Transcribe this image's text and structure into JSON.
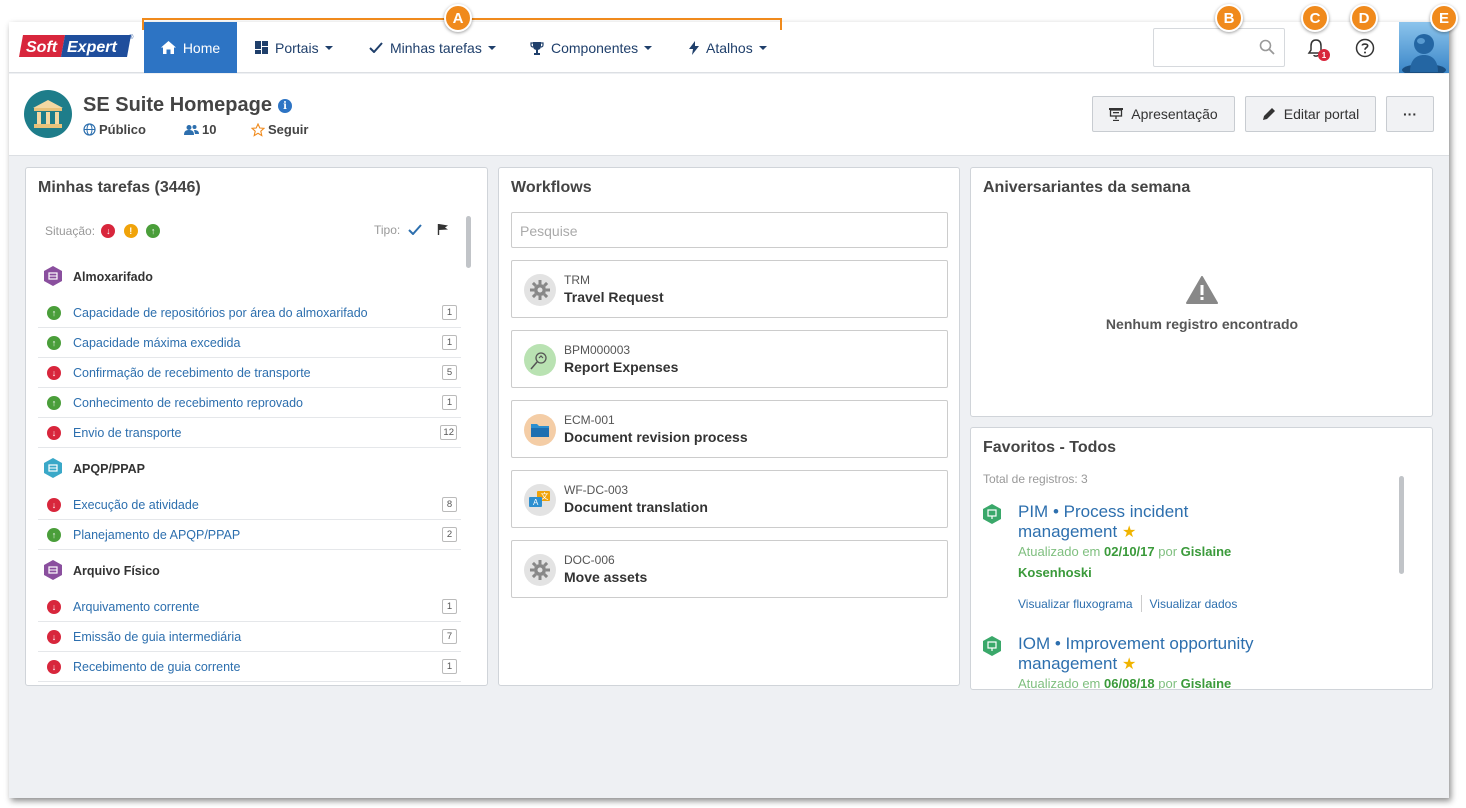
{
  "callouts": {
    "a": "A",
    "b": "B",
    "c": "C",
    "d": "D",
    "e": "E"
  },
  "brand": {
    "part1": "Soft",
    "part2": "Expert",
    "reg": "®"
  },
  "nav": {
    "home": "Home",
    "portais": "Portais",
    "minhas_tarefas": "Minhas tarefas",
    "componentes": "Componentes",
    "atalhos": "Atalhos"
  },
  "notifications": {
    "count": "1"
  },
  "header": {
    "title": "SE Suite Homepage",
    "visibility": "Público",
    "members": "10",
    "follow": "Seguir",
    "btn_presentation": "Apresentação",
    "btn_edit": "Editar portal",
    "btn_more": "···"
  },
  "tasks": {
    "title": "Minhas tarefas (3446)",
    "situacao_label": "Situação:",
    "tipo_label": "Tipo:",
    "groups": [
      {
        "name": "Almoxarifado",
        "color": "#8a4f9e",
        "items": [
          {
            "label": "Capacidade de repositórios por área do almoxarifado",
            "count": "1",
            "status": "green"
          },
          {
            "label": "Capacidade máxima excedida",
            "count": "1",
            "status": "green"
          },
          {
            "label": "Confirmação de recebimento de transporte",
            "count": "5",
            "status": "red"
          },
          {
            "label": "Conhecimento de recebimento reprovado",
            "count": "1",
            "status": "green"
          },
          {
            "label": "Envio de transporte",
            "count": "12",
            "status": "red"
          }
        ]
      },
      {
        "name": "APQP/PPAP",
        "color": "#3aa8c8",
        "items": [
          {
            "label": "Execução de atividade",
            "count": "8",
            "status": "red"
          },
          {
            "label": "Planejamento de APQP/PPAP",
            "count": "2",
            "status": "green"
          }
        ]
      },
      {
        "name": "Arquivo Físico",
        "color": "#8a4f9e",
        "items": [
          {
            "label": "Arquivamento corrente",
            "count": "1",
            "status": "red"
          },
          {
            "label": "Emissão de guia intermediária",
            "count": "7",
            "status": "red"
          },
          {
            "label": "Recebimento de guia corrente",
            "count": "1",
            "status": "red"
          }
        ]
      }
    ]
  },
  "workflows": {
    "title": "Workflows",
    "search_placeholder": "Pesquise",
    "items": [
      {
        "code": "TRM",
        "name": "Travel Request",
        "icon": "gear-icon"
      },
      {
        "code": "BPM000003",
        "name": "Report Expenses",
        "icon": "expenses-icon"
      },
      {
        "code": "ECM-001",
        "name": "Document revision process",
        "icon": "folder-icon"
      },
      {
        "code": "WF-DC-003",
        "name": "Document translation",
        "icon": "translate-icon"
      },
      {
        "code": "DOC-006",
        "name": "Move assets",
        "icon": "gear-icon"
      }
    ]
  },
  "birthdays": {
    "title": "Aniversariantes da semana",
    "empty": "Nenhum registro encontrado"
  },
  "favorites": {
    "title": "Favoritos - Todos",
    "total": "Total de registros: 3",
    "items": [
      {
        "title": "PIM • Process incident management",
        "updated_prefix": "Atualizado em",
        "date": "02/10/17",
        "by": "por",
        "author": "Gislaine Kosenhoski",
        "link1": "Visualizar fluxograma",
        "link2": "Visualizar dados"
      },
      {
        "title": "IOM • Improvement opportunity management",
        "updated_prefix": "Atualizado em",
        "date": "06/08/18",
        "by": "por",
        "author": "Gislaine"
      }
    ]
  }
}
